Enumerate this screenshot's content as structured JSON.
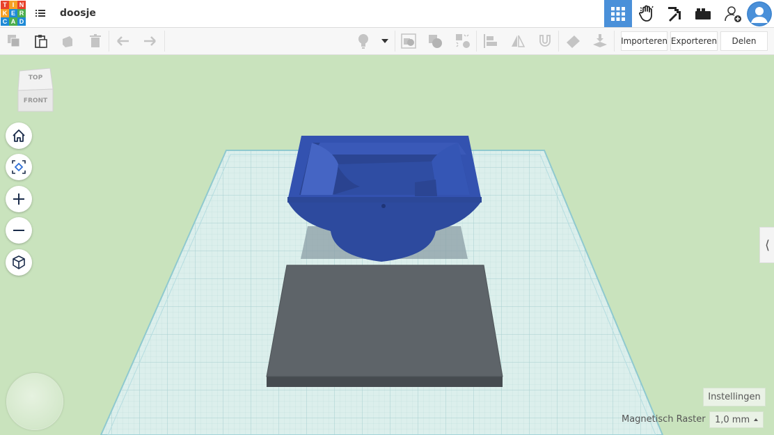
{
  "app": {
    "logo_letters": [
      "T",
      "I",
      "N",
      "K",
      "E",
      "R",
      "C",
      "A",
      "D"
    ],
    "logo_colors": [
      "#e8412a",
      "#f5a024",
      "#e8412a",
      "#f5a024",
      "#1e8ad6",
      "#4cae4f",
      "#1e8ad6",
      "#4cae4f",
      "#1e8ad6"
    ],
    "document_title": "doosje"
  },
  "header": {
    "icons": [
      "grid-view-icon",
      "hand-gesture-icon",
      "pickaxe-icon",
      "brick-icon",
      "add-user-icon",
      "profile-avatar-icon"
    ],
    "active_view": "3D design"
  },
  "toolbar": {
    "tools": [
      "copy-icon",
      "paste-icon",
      "duplicate-icon",
      "delete-icon",
      "undo-icon",
      "redo-icon",
      "light-bulb-icon",
      "dropdown-arrow-icon",
      "group-icon",
      "combine-icon",
      "ungroup-icon",
      "align-icon",
      "mirror-icon",
      "cruise-icon",
      "flag-icon",
      "drop-to-workplane-icon"
    ],
    "import_label": "Importeren",
    "export_label": "Exporteren",
    "share_label": "Delen"
  },
  "viewcube": {
    "top_label": "TOP",
    "front_label": "FRONT"
  },
  "navigation": {
    "buttons": [
      "home-view-icon",
      "fit-view-icon",
      "zoom-in-icon",
      "zoom-out-icon",
      "ortho-perspective-icon"
    ]
  },
  "workplane": {
    "color": "#d6ebe9",
    "shapes": [
      {
        "name": "blue box with curved cutout",
        "color": "#2f4fa6"
      },
      {
        "name": "gray box",
        "color": "#5e6469"
      }
    ]
  },
  "footer": {
    "settings_label": "Instellingen",
    "snap_grid_label": "Magnetisch Raster",
    "snap_grid_value": "1,0 mm"
  },
  "colors": {
    "accent": "#4a90d9",
    "background": "#c9e3bd"
  }
}
